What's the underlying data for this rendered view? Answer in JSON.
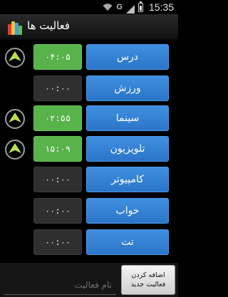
{
  "status_bar": {
    "network": "G",
    "time": "15:35"
  },
  "app": {
    "title": "فعالیت ها"
  },
  "activities": [
    {
      "name": "درس",
      "time": "۰۴:۰۵",
      "active": true
    },
    {
      "name": "ورزش",
      "time": "۰۰:۰۰",
      "active": false
    },
    {
      "name": "سینما",
      "time": "۰۲:۵۵",
      "active": true
    },
    {
      "name": "تلویزیون",
      "time": "۱۵:۰۹",
      "active": true
    },
    {
      "name": "کامپیوتر",
      "time": "۰۰:۰۰",
      "active": false
    },
    {
      "name": "خواب",
      "time": "۰۰:۰۰",
      "active": false
    },
    {
      "name": "تت",
      "time": "۰۰:۰۰",
      "active": false
    }
  ],
  "bottom": {
    "input_placeholder": "نام فعالیت",
    "add_button_line1": "اضافه کردن",
    "add_button_line2": "فعالیت جدید"
  },
  "colors": {
    "active_time": "#58b34a",
    "name_button": "#3a86d6",
    "alarm_icon": "#b9e04a"
  }
}
